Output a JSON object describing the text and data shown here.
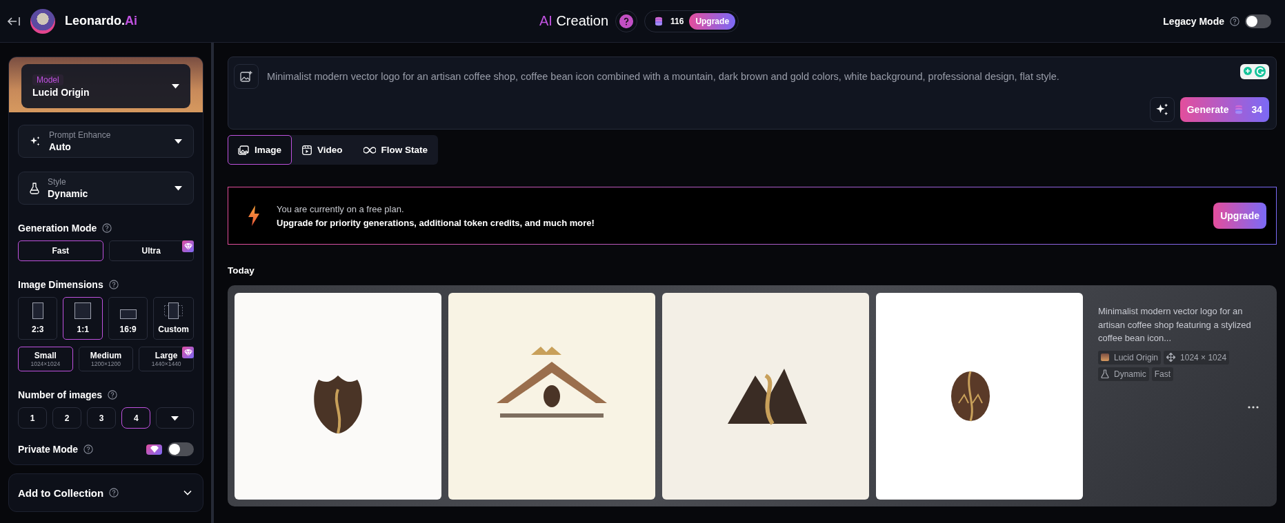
{
  "header": {
    "brand": {
      "name": "Leonardo.",
      "suffix": "Ai"
    },
    "title": {
      "accent": "AI",
      "text": "Creation"
    },
    "credits": "116",
    "upgrade": "Upgrade",
    "legacy_mode": {
      "label": "Legacy Mode",
      "on": false
    }
  },
  "sidebar": {
    "model": {
      "label": "Model",
      "value": "Lucid Origin"
    },
    "prompt_enhance": {
      "label": "Prompt Enhance",
      "value": "Auto"
    },
    "style": {
      "label": "Style",
      "value": "Dynamic"
    },
    "generation_mode": {
      "title": "Generation Mode",
      "options": [
        {
          "label": "Fast",
          "selected": true,
          "premium": false
        },
        {
          "label": "Ultra",
          "selected": false,
          "premium": true
        }
      ]
    },
    "image_dimensions": {
      "title": "Image Dimensions",
      "ratios": [
        {
          "kind": "portrait",
          "label": "2:3",
          "selected": false
        },
        {
          "kind": "square",
          "label": "1:1",
          "selected": true
        },
        {
          "kind": "landscape",
          "label": "16:9",
          "selected": false
        },
        {
          "kind": "custom",
          "label": "Custom",
          "selected": false
        }
      ],
      "sizes": [
        {
          "label": "Small",
          "resolution": "1024×1024",
          "selected": true,
          "premium": false
        },
        {
          "label": "Medium",
          "resolution": "1200×1200",
          "selected": false,
          "premium": false
        },
        {
          "label": "Large",
          "resolution": "1440×1440",
          "selected": false,
          "premium": true
        }
      ]
    },
    "number_of_images": {
      "title": "Number of images",
      "options": [
        {
          "label": "1",
          "selected": false
        },
        {
          "label": "2",
          "selected": false
        },
        {
          "label": "3",
          "selected": false
        },
        {
          "label": "4",
          "selected": true
        }
      ]
    },
    "private_mode": {
      "label": "Private Mode",
      "premium": true,
      "on": false
    },
    "add_to_collection": {
      "label": "Add to Collection",
      "expanded": false
    }
  },
  "prompt": {
    "value": "Minimalist modern vector logo for an artisan coffee shop, coffee bean icon combined with a mountain, dark brown and gold colors, white background, professional design, flat style.",
    "generate": "Generate",
    "cost": "34"
  },
  "tabs": [
    {
      "kind": "image",
      "label": "Image",
      "selected": true
    },
    {
      "kind": "video",
      "label": "Video",
      "selected": false
    },
    {
      "kind": "flow",
      "label": "Flow State",
      "selected": false
    }
  ],
  "banner": {
    "line1": "You are currently on a free plan.",
    "line2": "Upgrade for priority generations, additional token credits, and much more!",
    "button": "Upgrade"
  },
  "section": "Today",
  "generation": {
    "images": [
      {
        "kind": "tulip-bean"
      },
      {
        "kind": "roof-mountain"
      },
      {
        "kind": "m-mountain"
      },
      {
        "kind": "oval-bean"
      }
    ],
    "summary": "Minimalist modern vector logo for an artisan coffee shop featuring a stylized coffee bean icon...",
    "tags": [
      {
        "kind": "model",
        "label": "Lucid Origin"
      },
      {
        "kind": "dimensions",
        "label": "1024 × 1024"
      },
      {
        "kind": "style",
        "label": "Dynamic"
      },
      {
        "kind": "plain",
        "label": "Fast"
      }
    ]
  }
}
